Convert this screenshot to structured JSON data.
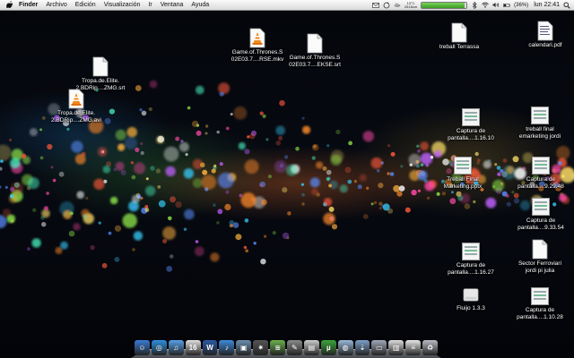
{
  "menubar": {
    "app_name": "Finder",
    "menus": [
      "Archivo",
      "Edición",
      "Visualización",
      "Ir",
      "Ventana",
      "Ayuda"
    ],
    "status": {
      "weather_temp": "13°C",
      "weather_sub": "2518cm",
      "battery_fraction": 0.95,
      "battery_percent": "(36%)",
      "clock": "lun 22:41"
    }
  },
  "desktop_icons": [
    {
      "name": "tropa-de-elite-srt",
      "type": "doc",
      "label": "Tropa.de.Elite.\n2.BDRip....ZMG.srt"
    },
    {
      "name": "tropa-de-elite-avi",
      "type": "vlc",
      "label": "Tropa.de.Elite.\n2.BDRip....ZMG.avi"
    },
    {
      "name": "got-mkv",
      "type": "vlc",
      "label": "Game.of.Thrones.S\n02E03.7....RSE.mkv"
    },
    {
      "name": "got-srt",
      "type": "doc",
      "label": "Game.of.Thrones.S\n02E03.7....EKSE.srt"
    },
    {
      "name": "treball-terrassa",
      "type": "doc",
      "label": "treball Terrassa"
    },
    {
      "name": "calendari-pdf",
      "type": "pdf",
      "label": "calendari.pdf"
    },
    {
      "name": "captura-1-16-10",
      "type": "thumb",
      "label": "Captura de\npantalla....1.16.10"
    },
    {
      "name": "treball-final-emarketing",
      "type": "thumb",
      "label": "treball final\nemarketing jordi"
    },
    {
      "name": "treball-final-marketing-pptx",
      "type": "thumb",
      "label": "Treball Final\nMarketing.pptx"
    },
    {
      "name": "captura-9-29-48",
      "type": "thumb",
      "label": "Captura de\npantalla....9.29.48"
    },
    {
      "name": "captura-9-33-54",
      "type": "thumb",
      "label": "Captura de\npantalla....9.33.54"
    },
    {
      "name": "captura-1-16-27",
      "type": "thumb",
      "label": "Captura de\npantalla....1.16.27"
    },
    {
      "name": "sector-ferroviari",
      "type": "doc",
      "label": "Sector Ferroviari\njordi pi julia"
    },
    {
      "name": "fluijo",
      "type": "disk",
      "label": "Fluijo 1.3.3"
    },
    {
      "name": "captura-1-10-28",
      "type": "thumb",
      "label": "Captura de\npantalla....1.10.28"
    }
  ],
  "dock": {
    "apps": [
      {
        "name": "finder",
        "color": "#3a7bd5",
        "glyph": "☺"
      },
      {
        "name": "safari",
        "color": "#2d8fe0",
        "glyph": "◎"
      },
      {
        "name": "itunes-store",
        "color": "#56a0e6",
        "glyph": "♫"
      },
      {
        "name": "ical",
        "color": "#e0e0e0",
        "glyph": "16"
      },
      {
        "name": "word",
        "color": "#2b5aa8",
        "glyph": "W"
      },
      {
        "name": "itunes",
        "color": "#3c8bd9",
        "glyph": "♪"
      },
      {
        "name": "iphoto",
        "color": "#6b8fb0",
        "glyph": "▣"
      },
      {
        "name": "burn",
        "color": "#555555",
        "glyph": "✷"
      },
      {
        "name": "spotify",
        "color": "#6ab04c",
        "glyph": "≋"
      },
      {
        "name": "xcode",
        "color": "#8a8a8a",
        "glyph": "✎"
      },
      {
        "name": "activity",
        "color": "#cccccc",
        "glyph": "▤"
      },
      {
        "name": "utorrent",
        "color": "#3aa63a",
        "glyph": "µ"
      },
      {
        "name": "preview",
        "color": "#9ab8d8",
        "glyph": "◍"
      },
      {
        "name": "downloads",
        "color": "#7aa0c8",
        "glyph": "⇣"
      },
      {
        "name": "documents",
        "color": "#a0a8b8",
        "glyph": "▭"
      },
      {
        "name": "stack",
        "color": "#dddddd",
        "glyph": "▥"
      },
      {
        "name": "notes",
        "color": "#e8e8e8",
        "glyph": "≡"
      },
      {
        "name": "trash",
        "color": "#b8bcc4",
        "glyph": "♻"
      }
    ]
  }
}
